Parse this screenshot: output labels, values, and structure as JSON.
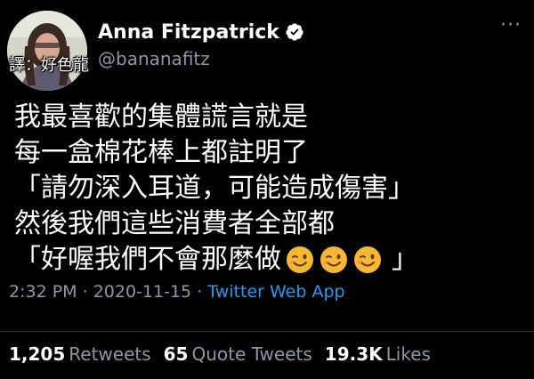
{
  "author": {
    "display_name": "Anna Fitzpatrick",
    "handle": "@bananafitz",
    "verified_icon": "verified-badge-icon",
    "avatar_icon": "profile-avatar",
    "watermark": "譯：好色龍"
  },
  "menu": {
    "more_icon": "more-options-icon",
    "more_glyph": "···"
  },
  "tweet": {
    "lines": [
      "我最喜歡的集體謊言就是",
      "每一盒棉花棒上都註明了",
      "「請勿深入耳道，可能造成傷害」",
      "然後我們這些消費者全部都"
    ],
    "last_line_text": "「好喔我們不會那麼做",
    "last_line_close": "」",
    "emoji_icon": "winking-face-emoji",
    "emoji_count": 3
  },
  "meta": {
    "time": "2:32 PM",
    "separator": "·",
    "date": "2020-11-15",
    "source": "Twitter Web App"
  },
  "stats": {
    "retweets_count": "1,205",
    "retweets_label": "Retweets",
    "quotes_count": "65",
    "quotes_label": "Quote Tweets",
    "likes_count": "19.3K",
    "likes_label": "Likes"
  },
  "colors": {
    "background": "#000000",
    "secondary_text": "#8b98a5",
    "link": "#1d9bf0",
    "verified": "#ffffff",
    "emoji": "#f7b733"
  }
}
